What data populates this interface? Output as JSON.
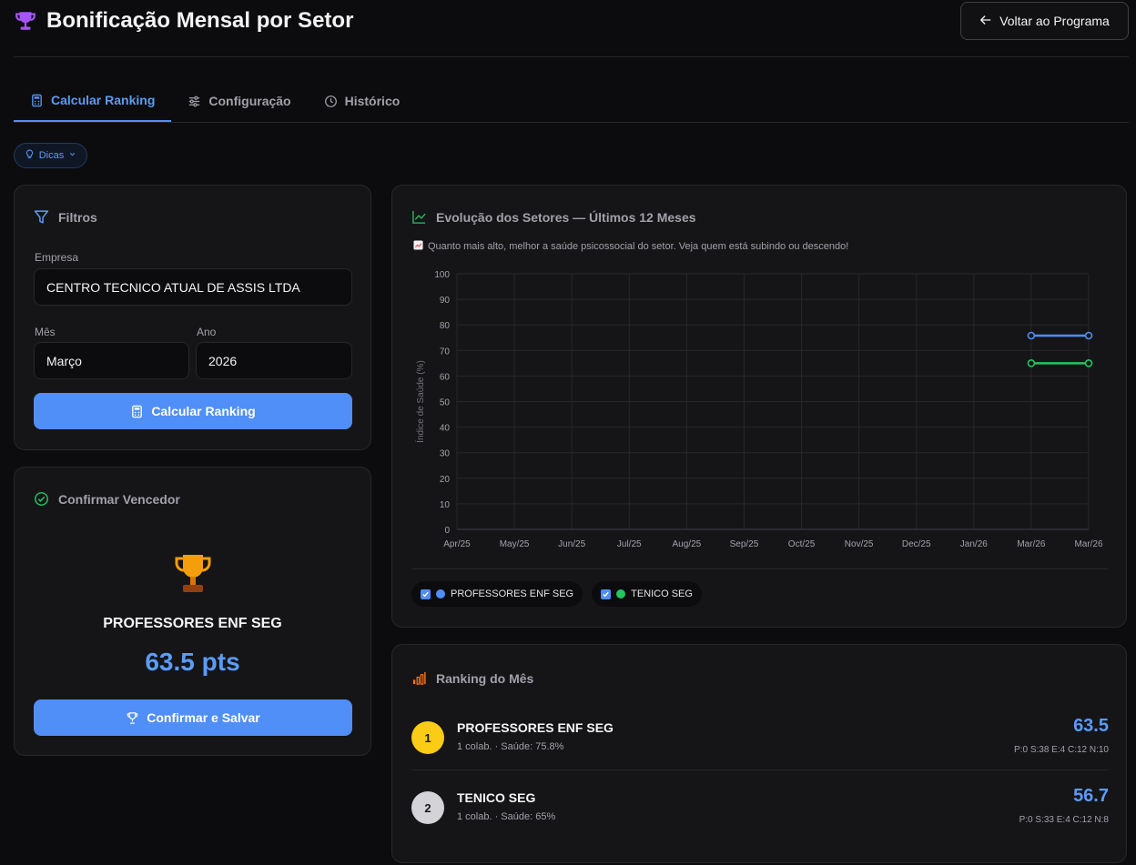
{
  "header": {
    "title": "Bonificação Mensal por Setor",
    "back_label": "Voltar ao Programa"
  },
  "tabs": [
    {
      "label": "Calcular Ranking",
      "active": true
    },
    {
      "label": "Configuração",
      "active": false
    },
    {
      "label": "Histórico",
      "active": false
    }
  ],
  "tips": {
    "label": "Dicas"
  },
  "filters": {
    "title": "Filtros",
    "company_label": "Empresa",
    "company_value": "CENTRO TECNICO ATUAL DE ASSIS LTDA",
    "month_label": "Mês",
    "month_value": "Março",
    "year_label": "Ano",
    "year_value": "2026",
    "calc_button": "Calcular Ranking"
  },
  "winner": {
    "title": "Confirmar Vencedor",
    "name": "PROFESSORES ENF SEG",
    "points": "63.5 pts",
    "confirm_button": "Confirmar e Salvar"
  },
  "evolution": {
    "title": "Evolução dos Setores — Últimos 12 Meses",
    "subtitle": "Quanto mais alto, melhor a saúde psicossocial do setor. Veja quem está subindo ou descendo!"
  },
  "chart_data": {
    "type": "line",
    "title": "",
    "xlabel": "",
    "ylabel": "Índice de Saúde (%)",
    "x": [
      "Apr/25",
      "May/25",
      "Jun/25",
      "Jul/25",
      "Aug/25",
      "Sep/25",
      "Oct/25",
      "Nov/25",
      "Dec/25",
      "Jan/26",
      "Mar/26",
      "Mar/26"
    ],
    "yticks": [
      0,
      10,
      20,
      30,
      40,
      50,
      60,
      70,
      80,
      90,
      100
    ],
    "ylim": [
      0,
      100
    ],
    "grid": true,
    "series": [
      {
        "name": "PROFESSORES ENF SEG",
        "color": "#4f8ff7",
        "values": [
          null,
          null,
          null,
          null,
          null,
          null,
          null,
          null,
          null,
          null,
          75.8,
          75.8
        ]
      },
      {
        "name": "TENICO SEG",
        "color": "#22c55e",
        "values": [
          null,
          null,
          null,
          null,
          null,
          null,
          null,
          null,
          null,
          null,
          65,
          65
        ]
      }
    ],
    "legend": "bottom-left"
  },
  "ranking": {
    "title": "Ranking do Mês",
    "rows": [
      {
        "position": "1",
        "name": "PROFESSORES ENF SEG",
        "meta": "1 colab. · Saúde: 75.8%",
        "score": "63.5",
        "detail": "P:0 S:38 E:4 C:12 N:10",
        "badge_color": "#facc15"
      },
      {
        "position": "2",
        "name": "TENICO SEG",
        "meta": "1 colab. · Saúde: 65%",
        "score": "56.7",
        "detail": "P:0 S:33 E:4 C:12 N:8",
        "badge_color": "#d4d4d8"
      }
    ]
  }
}
